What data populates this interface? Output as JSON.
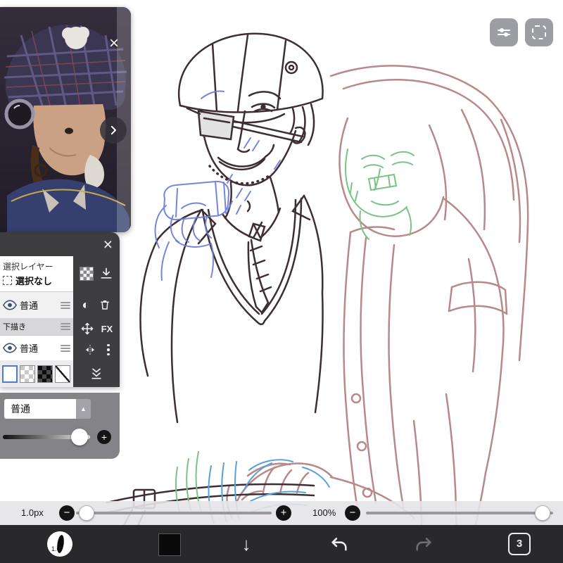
{
  "reference_panel": {
    "close_glyph": "×"
  },
  "layer_panel": {
    "close_glyph": "×",
    "title": "選択レイヤー",
    "selection_none_label": "選択なし",
    "layer1_name": "普通",
    "group_label": "下描き",
    "layer2_name": "普通",
    "fx_label": "FX",
    "contrast_glyph": "◐",
    "blend_value": "普通",
    "dropdown_up_glyph": "▲"
  },
  "footer_sliders": {
    "brush_size_value": "1.0px",
    "zoom_value": "100%",
    "minus_glyph": "−",
    "plus_glyph": "+"
  },
  "toolbar": {
    "brush_badge": "1.0",
    "down_arrow_glyph": "↓",
    "layer_count": "3"
  },
  "colors": {
    "panel_bg": "#38383a",
    "toolbar_bg": "#29292b",
    "canvas_bg": "#ffffff",
    "sketch_dark": "#3c2e34",
    "sketch_rose": "#b98989",
    "sketch_blue": "#6f7fd9",
    "sketch_green": "#7cc287",
    "sketch_sky": "#5aa0d8",
    "accent_blue": "#4a7bd8"
  }
}
